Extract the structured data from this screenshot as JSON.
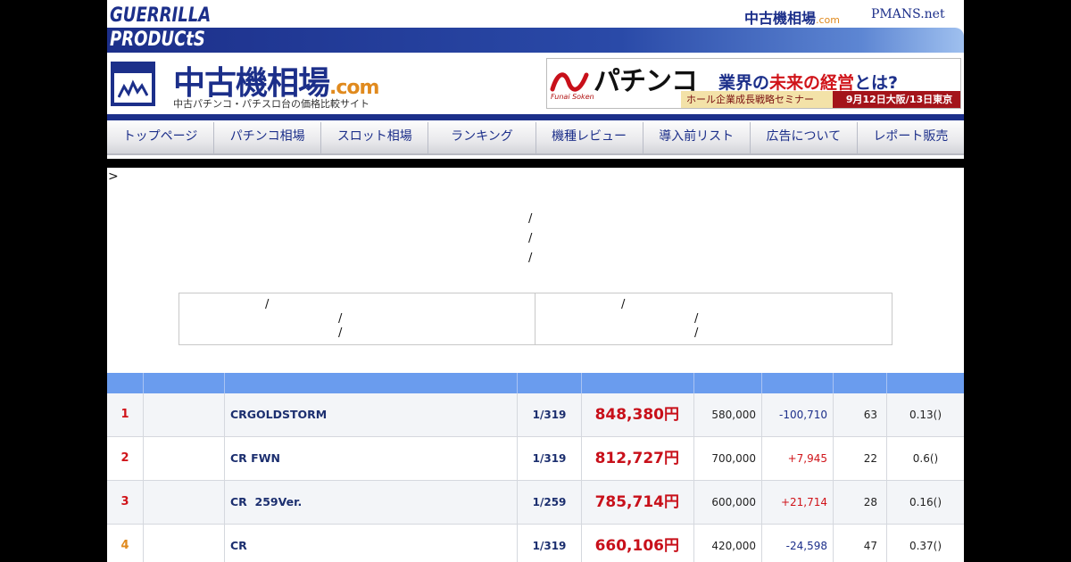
{
  "brand": {
    "guerrilla_line1": "GUERRILLA",
    "guerrilla_line2": "PRODUCtS",
    "toplink_site": "中古機相場",
    "toplink_site_suffix": ".com",
    "toplink_pmans": "PMANS.net"
  },
  "site": {
    "title": "中古機相場",
    "title_suffix": ".com",
    "subtitle": "中古パチンコ・パチスロ台の価格比較サイト"
  },
  "ad": {
    "brand": "Funai Soken",
    "headline": "パチンコ",
    "headline2_a": "業界の",
    "headline2_b": "未来の経営",
    "headline2_c": "とは?",
    "seminar": "ホール企業成長戦略セミナー",
    "dates": "9月12日大阪/13日東京"
  },
  "nav": [
    {
      "label": "トップページ"
    },
    {
      "label": "パチンコ相場"
    },
    {
      "label": "スロット相場"
    },
    {
      "label": "ランキング"
    },
    {
      "label": "機種レビュー"
    },
    {
      "label": "導入前リスト"
    },
    {
      "label": "広告について"
    },
    {
      "label": "レポート販売"
    }
  ],
  "breadcrumb": ">",
  "slash": "/",
  "table": {
    "rows": [
      {
        "rank": "1",
        "name": "CRGOLDSTORM",
        "prob": "1/319",
        "price": "848,380円",
        "base": "580,000",
        "diff": "-100,710",
        "count": "63",
        "ratio": "0.13()"
      },
      {
        "rank": "2",
        "name": "CR FWN",
        "prob": "1/319",
        "price": "812,727円",
        "base": "700,000",
        "diff": "+7,945",
        "count": "22",
        "ratio": "0.6()"
      },
      {
        "rank": "3",
        "name": "CR  259Ver.",
        "prob": "1/259",
        "price": "785,714円",
        "base": "600,000",
        "diff": "+21,714",
        "count": "28",
        "ratio": "0.16()"
      },
      {
        "rank": "4",
        "name": "CR",
        "prob": "1/319",
        "price": "660,106円",
        "base": "420,000",
        "diff": "-24,598",
        "count": "47",
        "ratio": "0.37()"
      }
    ]
  },
  "colors": {
    "brand_navy": "#1c2f8a",
    "accent_orange": "#e08a1e",
    "price_red": "#c8101a",
    "table_header_blue": "#6a9cee"
  }
}
